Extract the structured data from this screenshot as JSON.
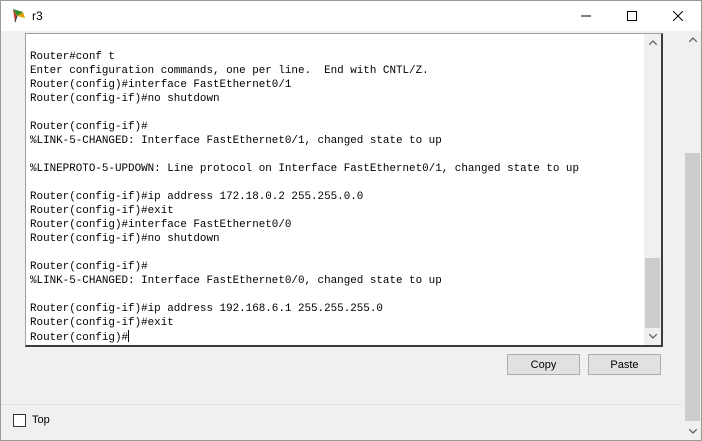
{
  "window": {
    "title": "r3",
    "icon": "cisco-router-icon"
  },
  "titlebar_buttons": {
    "minimize": "minimize-icon",
    "maximize": "maximize-icon",
    "close": "close-icon"
  },
  "terminal": {
    "lines": [
      "Router#conf t",
      "Enter configuration commands, one per line.  End with CNTL/Z.",
      "Router(config)#interface FastEthernet0/1",
      "Router(config-if)#no shutdown",
      "",
      "Router(config-if)#",
      "%LINK-5-CHANGED: Interface FastEthernet0/1, changed state to up",
      "",
      "%LINEPROTO-5-UPDOWN: Line protocol on Interface FastEthernet0/1, changed state to up",
      "",
      "Router(config-if)#ip address 172.18.0.2 255.255.0.0",
      "Router(config-if)#exit",
      "Router(config)#interface FastEthernet0/0",
      "Router(config-if)#no shutdown",
      "",
      "Router(config-if)#",
      "%LINK-5-CHANGED: Interface FastEthernet0/0, changed state to up",
      "",
      "Router(config-if)#ip address 192.168.6.1 255.255.255.0",
      "Router(config-if)#exit",
      "Router(config)#"
    ]
  },
  "buttons": {
    "copy": "Copy",
    "paste": "Paste"
  },
  "options": {
    "top_label": "Top",
    "top_checked": false
  },
  "colors": {
    "window_bg": "#f0f0f0",
    "terminal_bg": "#ffffff",
    "scroll_thumb": "#cdcdcd"
  }
}
